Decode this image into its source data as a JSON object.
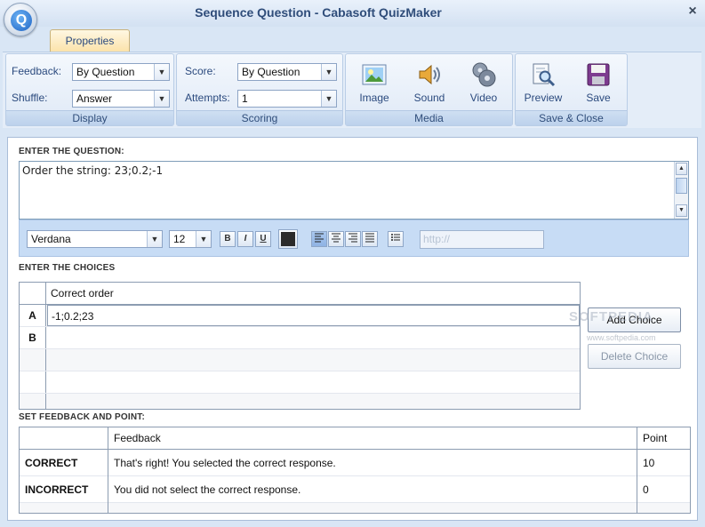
{
  "window": {
    "title": "Sequence Question - Cabasoft QuizMaker",
    "close_symbol": "×",
    "logo_letter": "Q"
  },
  "tabs": {
    "properties": "Properties"
  },
  "ribbon": {
    "display": {
      "caption": "Display",
      "feedback_label": "Feedback:",
      "feedback_value": "By Question",
      "shuffle_label": "Shuffle:",
      "shuffle_value": "Answer"
    },
    "scoring": {
      "caption": "Scoring",
      "score_label": "Score:",
      "score_value": "By Question",
      "attempts_label": "Attempts:",
      "attempts_value": "1"
    },
    "media": {
      "caption": "Media",
      "image": "Image",
      "sound": "Sound",
      "video": "Video"
    },
    "save_close": {
      "caption": "Save & Close",
      "preview": "Preview",
      "save": "Save"
    }
  },
  "question": {
    "section_label": "ENTER THE QUESTION:",
    "text": "Order the string: 23;0.2;-1"
  },
  "format_bar": {
    "font": "Verdana",
    "size": "12",
    "bold": "B",
    "italic": "I",
    "underline": "U",
    "url_placeholder": "http://",
    "text_color": "#2b2b2b"
  },
  "choices": {
    "section_label": "ENTER THE CHOICES",
    "column_header": "Correct order",
    "rows": [
      {
        "index": "A",
        "value": "-1;0.2;23"
      },
      {
        "index": "B",
        "value": ""
      }
    ],
    "add_button": "Add Choice",
    "delete_button": "Delete Choice"
  },
  "feedback": {
    "section_label": "SET FEEDBACK AND POINT:",
    "headers": {
      "feedback": "Feedback",
      "point": "Point"
    },
    "rows": [
      {
        "label": "CORRECT",
        "text": "That's right!  You selected the correct response.",
        "point": "10"
      },
      {
        "label": "INCORRECT",
        "text": "You did not select the correct response.",
        "point": "0"
      }
    ]
  },
  "watermark": {
    "main": "SOFTPEDIA",
    "sub": "www.softpedia.com"
  },
  "colors": {
    "accent": "#2f4d7a",
    "tab": "#fbe2a8",
    "ribbon": "#e4edf8"
  }
}
